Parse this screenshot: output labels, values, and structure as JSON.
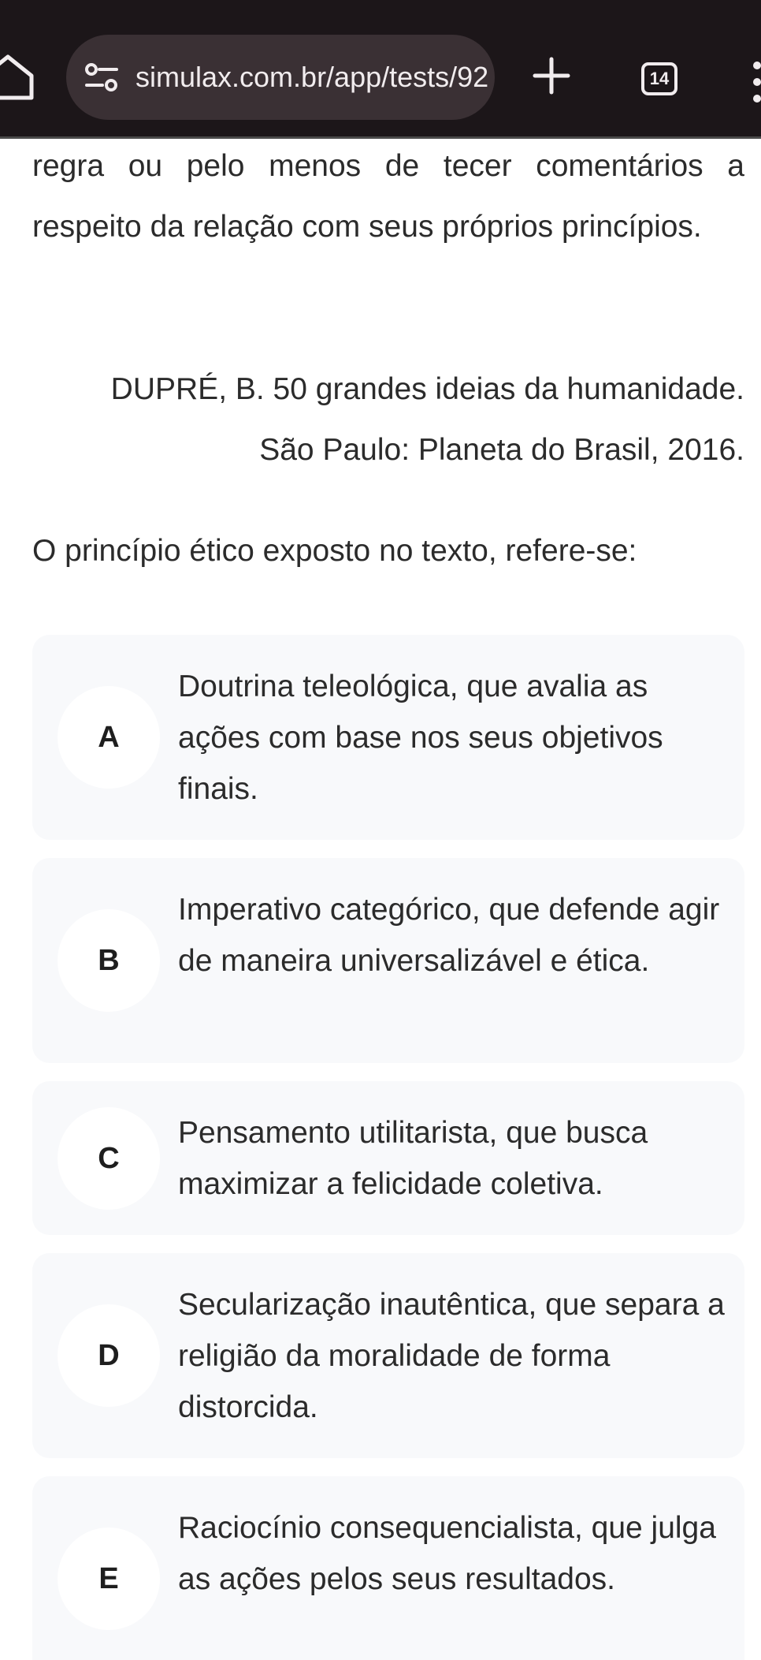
{
  "browser": {
    "url": "simulax.com.br/app/tests/92",
    "tab_count": "14"
  },
  "passage": {
    "text": "regra ou pelo menos de tecer comentários a respeito da relação com seus próprios princípios."
  },
  "citation": {
    "line1": "DUPRÉ, B. 50 grandes ideias da humanidade.",
    "line2": "São Paulo: Planeta do Brasil, 2016."
  },
  "question": {
    "text": "O princípio ético exposto no texto, refere-se:"
  },
  "options": [
    {
      "letter": "A",
      "text": "Doutrina teleológica, que avalia as ações com base nos seus objetivos finais."
    },
    {
      "letter": "B",
      "text": "Imperativo categórico, que defende agir de maneira universalizável e ética."
    },
    {
      "letter": "C",
      "text": "Pensamento utilitarista, que busca maximizar a felicidade coletiva."
    },
    {
      "letter": "D",
      "text": "Secularização inautêntica, que separa a religião da moralidade de forma distorcida."
    },
    {
      "letter": "E",
      "text": "Raciocínio consequencialista, que julga as ações pelos seus resultados."
    }
  ]
}
